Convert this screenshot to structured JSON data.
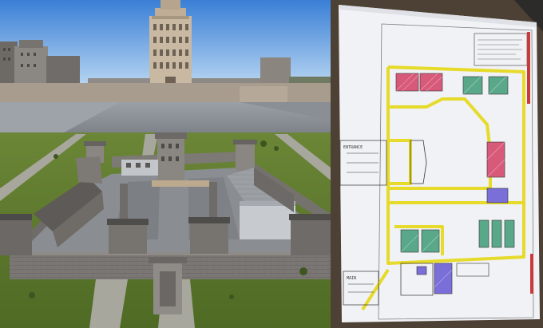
{
  "render": {
    "sky_top": "#3a7fd6",
    "sky_bottom": "#b9d8f5",
    "grass": "#5e7a2c",
    "concrete": "#8f9399",
    "wall": "#7d7b78"
  },
  "sketch": {
    "paper": "#f2f3f6",
    "corridor_color": "#e8dc2c",
    "room_colors": [
      "#d85a7a",
      "#5aa88a",
      "#7a6ed8",
      "#c24a5a"
    ],
    "labels": {
      "entrance": "ENTRANCE",
      "main": "MAIN"
    }
  }
}
